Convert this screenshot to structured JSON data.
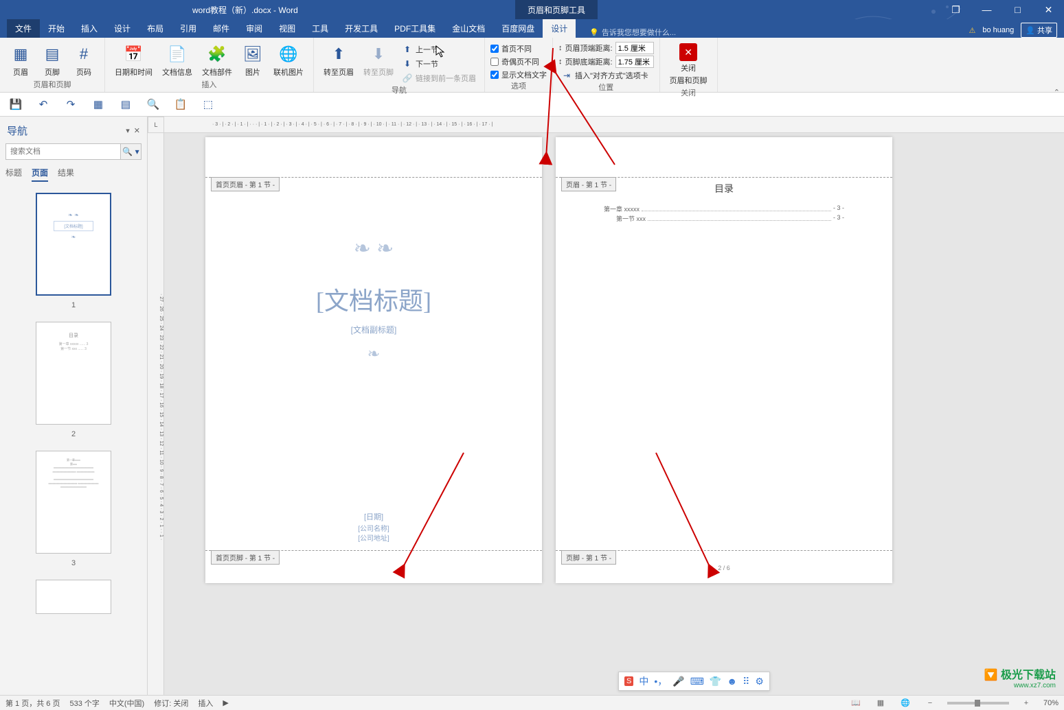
{
  "titlebar": {
    "doc_title": "word教程（新）.docx - Word",
    "context_tab": "页眉和页脚工具",
    "restore_icon": "❐",
    "min_icon": "—",
    "max_icon": "□",
    "close_icon": "✕"
  },
  "tabs": {
    "file": "文件",
    "home": "开始",
    "insert": "插入",
    "design": "设计",
    "layout": "布局",
    "references": "引用",
    "mailings": "邮件",
    "review": "审阅",
    "view": "视图",
    "tools": "工具",
    "dev": "开发工具",
    "pdf": "PDF工具集",
    "jinshan": "金山文档",
    "baidu": "百度网盘",
    "hf_design": "设计",
    "tell_me_placeholder": "告诉我您想要做什么...",
    "user_warn": "⚠",
    "user_name": "bo huang",
    "share": "共享"
  },
  "ribbon": {
    "group_hf": "页眉和页脚",
    "header": "页眉",
    "footer": "页脚",
    "page_number": "页码",
    "group_insert": "插入",
    "date_time": "日期和时间",
    "doc_info": "文档信息",
    "doc_parts": "文档部件",
    "picture": "图片",
    "online_pic": "联机图片",
    "group_nav": "导航",
    "goto_header": "转至页眉",
    "goto_footer": "转至页脚",
    "prev": "上一节",
    "next": "下一节",
    "link_prev": "链接到前一条页眉",
    "group_options": "选项",
    "diff_first": "首页不同",
    "diff_odd_even": "奇偶页不同",
    "show_doc_text": "显示文档文字",
    "group_position": "位置",
    "header_top_label": "页眉顶端距离:",
    "header_top_val": "1.5 厘米",
    "footer_bottom_label": "页脚底端距离:",
    "footer_bottom_val": "1.75 厘米",
    "insert_align_tab": "插入\"对齐方式\"选项卡",
    "group_close": "关闭",
    "close_btn_l1": "关闭",
    "close_btn_l2": "页眉和页脚"
  },
  "qat": {
    "save": "💾",
    "undo": "↶",
    "redo": "↷",
    "tbl": "▦",
    "tr": "▤",
    "zoom": "🔍",
    "paste": "📋",
    "obj": "⬚"
  },
  "nav": {
    "title": "导航",
    "search_placeholder": "搜索文档",
    "tab_headings": "标题",
    "tab_pages": "页面",
    "tab_results": "结果",
    "thumb1_num": "1",
    "thumb2_num": "2",
    "thumb3_num": "3",
    "thumb_title_text": "[文档标题]"
  },
  "hruler_text": "· 3 · | · 2 · | · 1 · | · · · | · 1 · | · 2 · | · 3 · | · 4 · | · 5 · | · 6 · | · 7 · | · 8 · | · 9 · | · 10 · | · 11 · | · 12 · | · 13 · | · 14 · | · 15 · | · 16 · | · 17 · |",
  "vruler_text": "· 27 · 26 · 25 · 24 · 23 · 22 · 21 · 20 · 19 · 18 · 17 · 16 · 15 · 14 · 13 · 12 · 11 · 10 · 9 · 8 · 7 · 6 · 5 · 4 · 3 · 2 · 1 · · 1 ·",
  "page1": {
    "header_label": "首页页眉 - 第 1 节 -",
    "footer_label": "首页页脚 - 第 1 节 -",
    "title": "[文档标题]",
    "subtitle": "[文档副标题]",
    "date": "[日期]",
    "company": "[公司名称]",
    "address": "[公司地址]",
    "flourish1": "❧ ❧",
    "flourish2": "❧"
  },
  "page2": {
    "header_label": "页眉 - 第 1 节 -",
    "footer_label": "页脚 - 第 1 节 -",
    "toc_title": "目录",
    "toc1_label": "第一章  xxxxx",
    "toc1_page": "- 3 -",
    "toc2_label": "第一节  xxx",
    "toc2_page": "- 3 -",
    "page_num": "2 / 6"
  },
  "status": {
    "page": "第 1 页，共 6 页",
    "words": "533 个字",
    "lang": "中文(中国)",
    "track": "修订: 关闭",
    "insert": "插入",
    "zoom": "70%"
  },
  "ime": {
    "logo": "S",
    "cn": "中",
    "punct": "•，",
    "mic": "🎤",
    "kbd": "⌨",
    "shirt": "👕",
    "face": "☻",
    "grid": "⠿",
    "gear": "⚙"
  },
  "watermark": {
    "l1": "🔽 极光下载站",
    "l2": "www.xz7.com"
  }
}
